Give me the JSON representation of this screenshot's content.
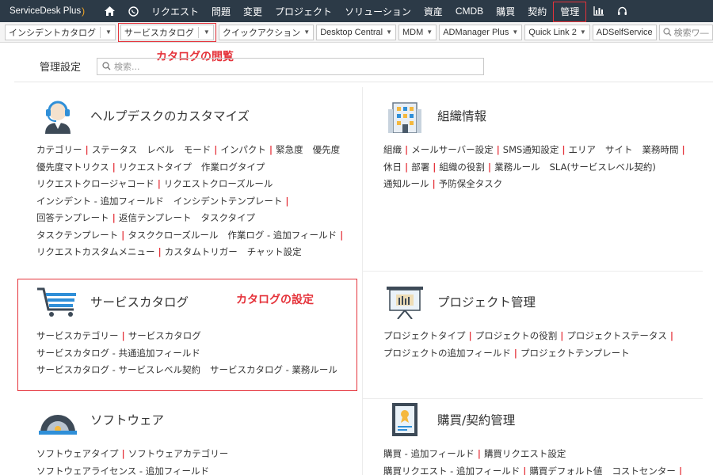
{
  "topbar": {
    "logo": "ServiceDesk Plus",
    "items": [
      "リクエスト",
      "問題",
      "変更",
      "プロジェクト",
      "ソリューション",
      "資産",
      "CMDB",
      "購買",
      "契約",
      "管理"
    ],
    "icons": [
      "home-icon",
      "whatsapp-icon",
      "chart-icon",
      "headset-icon"
    ]
  },
  "toolbar": {
    "items": [
      "インシデントカタログ",
      "サービスカタログ",
      "クイックアクション",
      "Desktop Central",
      "MDM",
      "ADManager Plus",
      "Quick Link 2",
      "ADSelfService"
    ],
    "search_placeholder": "検索ワ―"
  },
  "callouts": {
    "catalog_view": "カタログの閲覧",
    "catalog_settings": "カタログの設定"
  },
  "admin": {
    "title": "管理設定",
    "search_placeholder": "検索..."
  },
  "panels": {
    "helpdesk": {
      "title": "ヘルプデスクのカスタマイズ",
      "rows": [
        [
          "カテゴリー",
          "|",
          "ステータス",
          " ",
          "レベル",
          " ",
          "モード",
          "|",
          "インパクト",
          "|",
          "緊急度",
          " ",
          "優先度"
        ],
        [
          "優先度マトリクス",
          "|",
          "リクエストタイプ",
          " ",
          "作業ログタイプ"
        ],
        [
          "リクエストクロージャコード",
          "|",
          "リクエストクローズルール"
        ],
        [
          "インシデント - 追加フィールド",
          " ",
          "インシデントテンプレート",
          "|"
        ],
        [
          "回答テンプレート",
          "|",
          "返信テンプレート",
          " ",
          "タスクタイプ"
        ],
        [
          "タスクテンプレート",
          "|",
          "タスククローズルール",
          " ",
          "作業ログ - 追加フィールド",
          "|"
        ],
        [
          "リクエストカスタムメニュー",
          "|",
          "カスタムトリガー",
          " ",
          "チャット設定"
        ]
      ]
    },
    "org": {
      "title": "組織情報",
      "rows": [
        [
          "組織",
          "|",
          "メールサーバー設定",
          "|",
          "SMS通知設定",
          "|",
          "エリア",
          " ",
          "サイト",
          " ",
          "業務時間",
          "|"
        ],
        [
          "休日",
          "|",
          "部署",
          "|",
          "組織の役割",
          "|",
          "業務ルール",
          " ",
          "SLA(サービスレベル契約)"
        ],
        [
          "通知ルール",
          "|",
          "予防保全タスク"
        ]
      ]
    },
    "catalog": {
      "title": "サービスカタログ",
      "rows": [
        [
          "サービスカテゴリー",
          "|",
          "サービスカタログ"
        ],
        [
          "サービスカタログ - 共通追加フィールド"
        ],
        [
          "サービスカタログ - サービスレベル契約",
          " ",
          "サービスカタログ - 業務ルール"
        ]
      ]
    },
    "project": {
      "title": "プロジェクト管理",
      "rows": [
        [
          "プロジェクトタイプ",
          "|",
          "プロジェクトの役割",
          "|",
          "プロジェクトステータス",
          "|"
        ],
        [
          "プロジェクトの追加フィールド",
          "|",
          "プロジェクトテンプレート"
        ]
      ]
    },
    "software": {
      "title": "ソフトウェア",
      "rows": [
        [
          "ソフトウェアタイプ",
          "|",
          "ソフトウェアカテゴリー"
        ],
        [
          "ソフトウェアライセンス - 追加フィールド"
        ]
      ]
    },
    "purchase": {
      "title": "購買/契約管理",
      "rows": [
        [
          "購買 - 追加フィールド",
          "|",
          "購買リクエスト設定"
        ],
        [
          "購買リクエスト - 追加フィールド",
          "|",
          "購買デフォルト値",
          " ",
          "コストセンター",
          "|"
        ]
      ]
    }
  },
  "colors": {
    "topbar": "#2c3a47",
    "accent_red": "#e5333b",
    "icon_blue": "#2f8fd8"
  }
}
